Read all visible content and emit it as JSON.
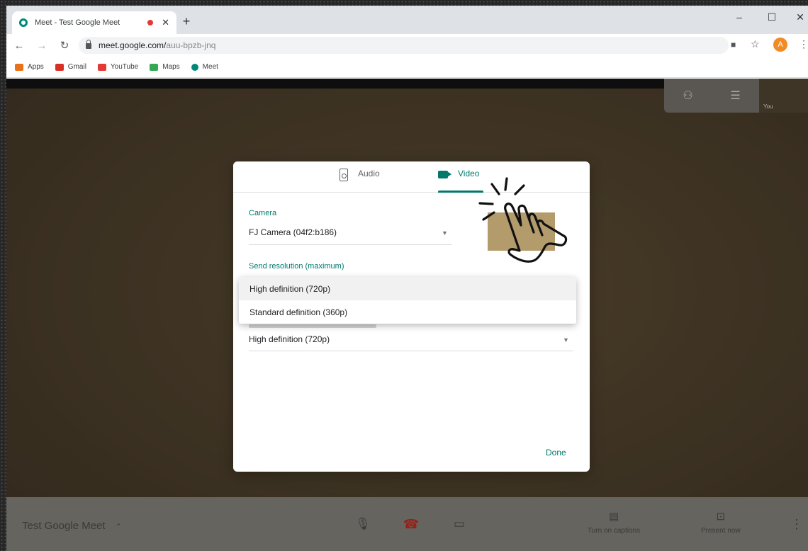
{
  "browser": {
    "tab_title": "Meet - Test Google Meet",
    "url_host": "meet.google.com/",
    "url_path": "auu-bpzb-jnq",
    "avatar_letter": "A",
    "bookmarks": [
      {
        "label": "Apps",
        "color": "#e8711a"
      },
      {
        "label": "Gmail",
        "color": "#d93025"
      },
      {
        "label": "YouTube",
        "color": "#e53935"
      },
      {
        "label": "Maps",
        "color": "#34a853"
      },
      {
        "label": "Meet",
        "color": "#00897b"
      }
    ]
  },
  "meet": {
    "self_label": "You",
    "meeting_title": "Test Google Meet",
    "captions_label": "Turn on captions",
    "present_label": "Present now"
  },
  "dialog": {
    "tab_audio": "Audio",
    "tab_video": "Video",
    "camera_label": "Camera",
    "camera_value": "FJ Camera (04f2:b186)",
    "send_res_label": "Send resolution (maximum)",
    "send_res_options": [
      "High definition (720p)",
      "Standard definition (360p)"
    ],
    "recv_res_value": "High definition (720p)",
    "done_label": "Done"
  },
  "colors": {
    "accent": "#00796b",
    "hangup": "#b42a20"
  }
}
